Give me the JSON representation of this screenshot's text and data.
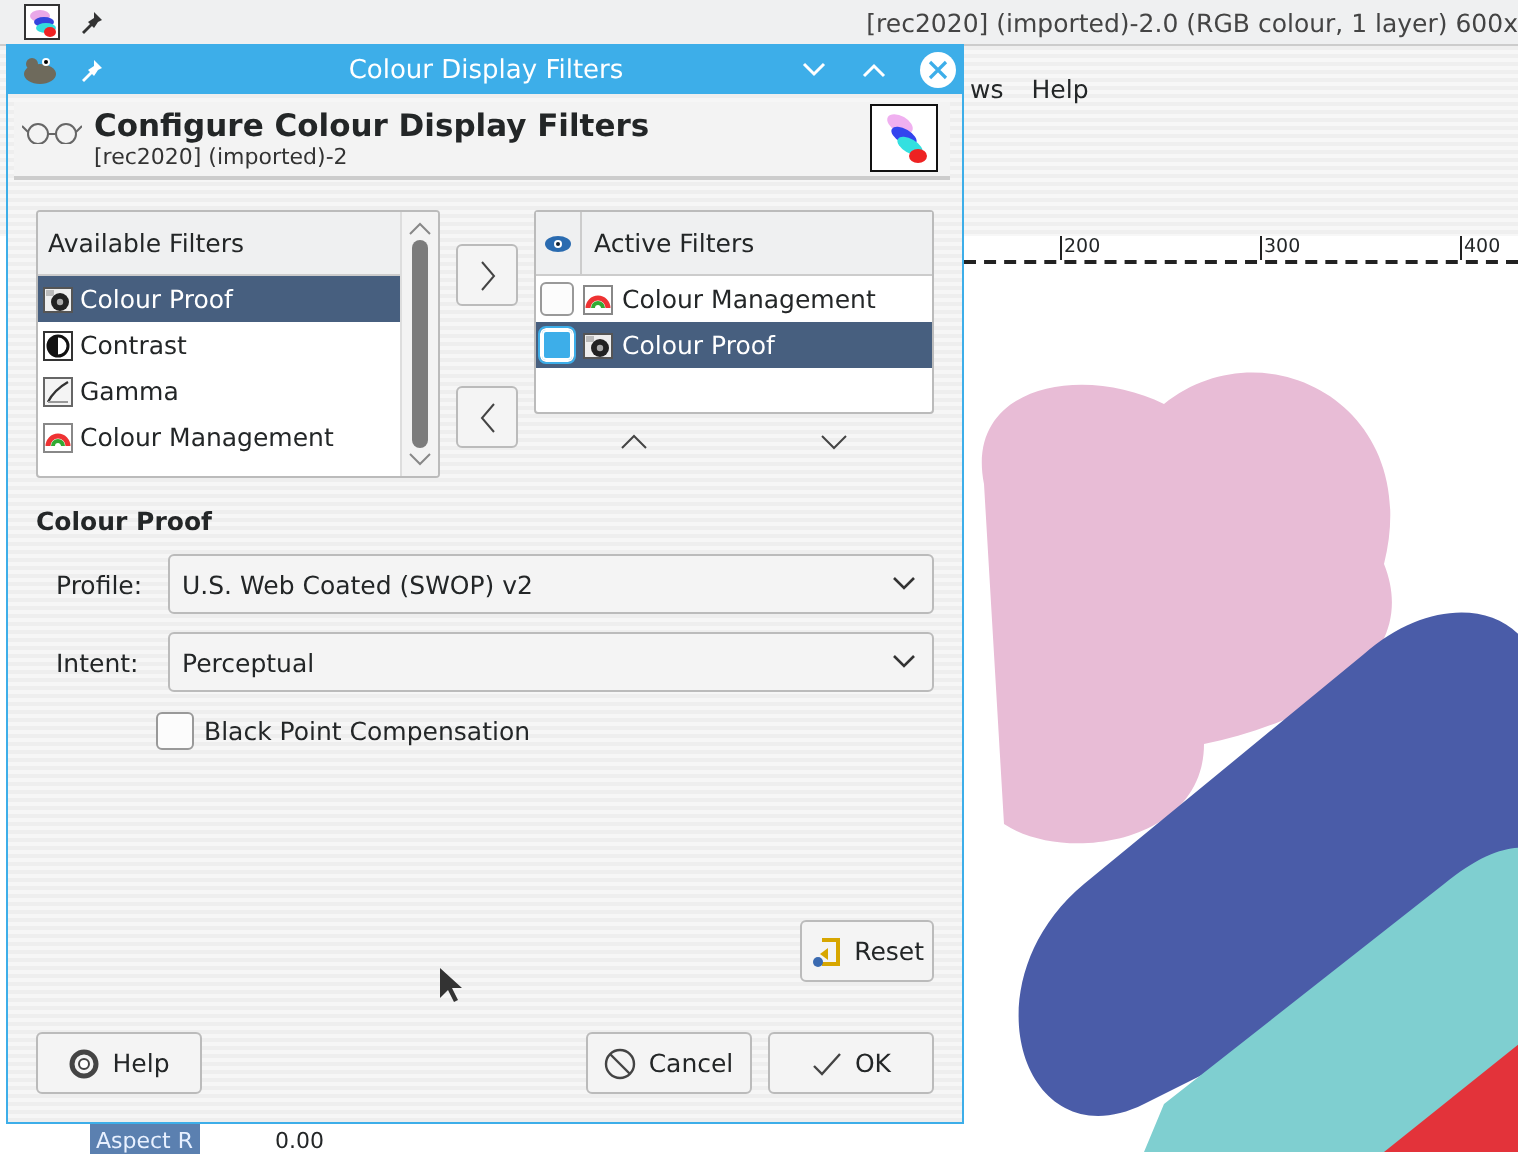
{
  "app_window": {
    "title": "[rec2020] (imported)-2.0 (RGB colour, 1 layer) 600x",
    "menu": [
      "ws",
      "Help"
    ],
    "ruler_labels": [
      "200",
      "300",
      "400"
    ],
    "bottom_field": {
      "label": "Aspect R",
      "value": "0.00"
    }
  },
  "dialog": {
    "title": "Colour Display Filters",
    "heading": "Configure Colour Display Filters",
    "subtitle": "[rec2020] (imported)-2",
    "available": {
      "header": "Available Filters",
      "items": [
        {
          "label": "Colour Proof",
          "kind": "proof",
          "selected": true
        },
        {
          "label": "Contrast",
          "kind": "contrast",
          "selected": false
        },
        {
          "label": "Gamma",
          "kind": "gamma",
          "selected": false
        },
        {
          "label": "Colour Management",
          "kind": "management",
          "selected": false
        }
      ]
    },
    "active": {
      "header": "Active Filters",
      "items": [
        {
          "label": "Colour Management",
          "kind": "management",
          "on": false,
          "selected": false
        },
        {
          "label": "Colour Proof",
          "kind": "proof",
          "on": true,
          "selected": true
        }
      ]
    },
    "section_title": "Colour Proof",
    "fields": [
      {
        "label": "Profile:",
        "value": "U.S. Web Coated (SWOP) v2"
      },
      {
        "label": "Intent:",
        "value": "Perceptual"
      }
    ],
    "checkbox": {
      "label": "Black Point Compensation",
      "checked": false
    },
    "reset_button": "Reset",
    "help_button": "Help",
    "cancel_button": "Cancel",
    "ok_button": "OK"
  }
}
